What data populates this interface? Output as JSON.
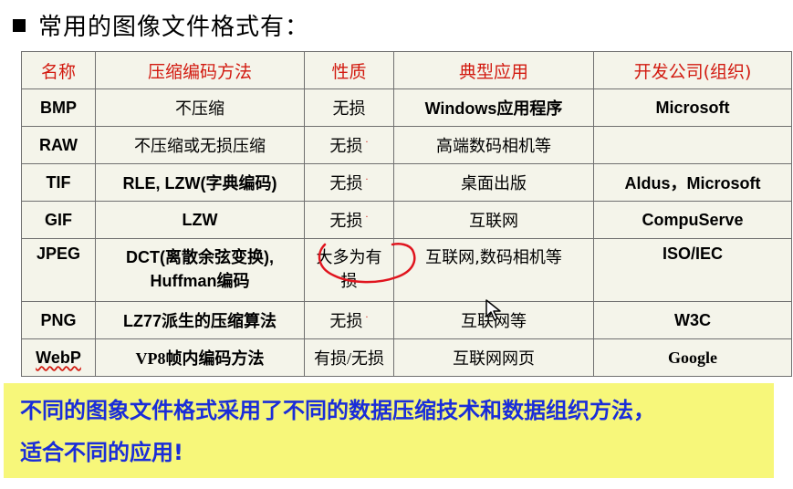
{
  "heading": "常用的图像文件格式有：",
  "table": {
    "headers": [
      "名称",
      "压缩编码方法",
      "性质",
      "典型应用",
      "开发公司(组织)"
    ],
    "rows": [
      {
        "name": "BMP",
        "method": "不压缩",
        "nature": "无损",
        "app": "Windows应用程序",
        "company": "Microsoft"
      },
      {
        "name": "RAW",
        "method": "不压缩或无损压缩",
        "nature": "无损",
        "app": "高端数码相机等",
        "company": ""
      },
      {
        "name": "TIF",
        "method": "RLE, LZW(字典编码)",
        "nature": "无损",
        "app": "桌面出版",
        "company": "Aldus，Microsoft"
      },
      {
        "name": "GIF",
        "method": "LZW",
        "nature": "无损",
        "app": "互联网",
        "company": "CompuServe"
      },
      {
        "name": "JPEG",
        "method_line1": "DCT(离散余弦变换),",
        "method_line2": "Huffman编码",
        "nature": "大多为有损",
        "app": "互联网,数码相机等",
        "company": "ISO/IEC"
      },
      {
        "name": "PNG",
        "method": "LZ77派生的压缩算法",
        "nature": "无损",
        "app": "互联网等",
        "company": "W3C"
      },
      {
        "name": "WebP",
        "method": "VP8帧内编码方法",
        "nature": "有损/无损",
        "app": "互联网网页",
        "company": "Google"
      }
    ]
  },
  "summary": {
    "line1": "不同的图象文件格式采用了不同的数据压缩技术和数据组织方法，",
    "line2": "适合不同的应用!"
  },
  "colors": {
    "header_text": "#d21a10",
    "summary_text": "#1a2dd8",
    "summary_bg": "#f7f77a",
    "annotation": "#e0141e"
  },
  "icons": {
    "bullet": "square-bullet",
    "cursor": "mouse-pointer-icon"
  }
}
